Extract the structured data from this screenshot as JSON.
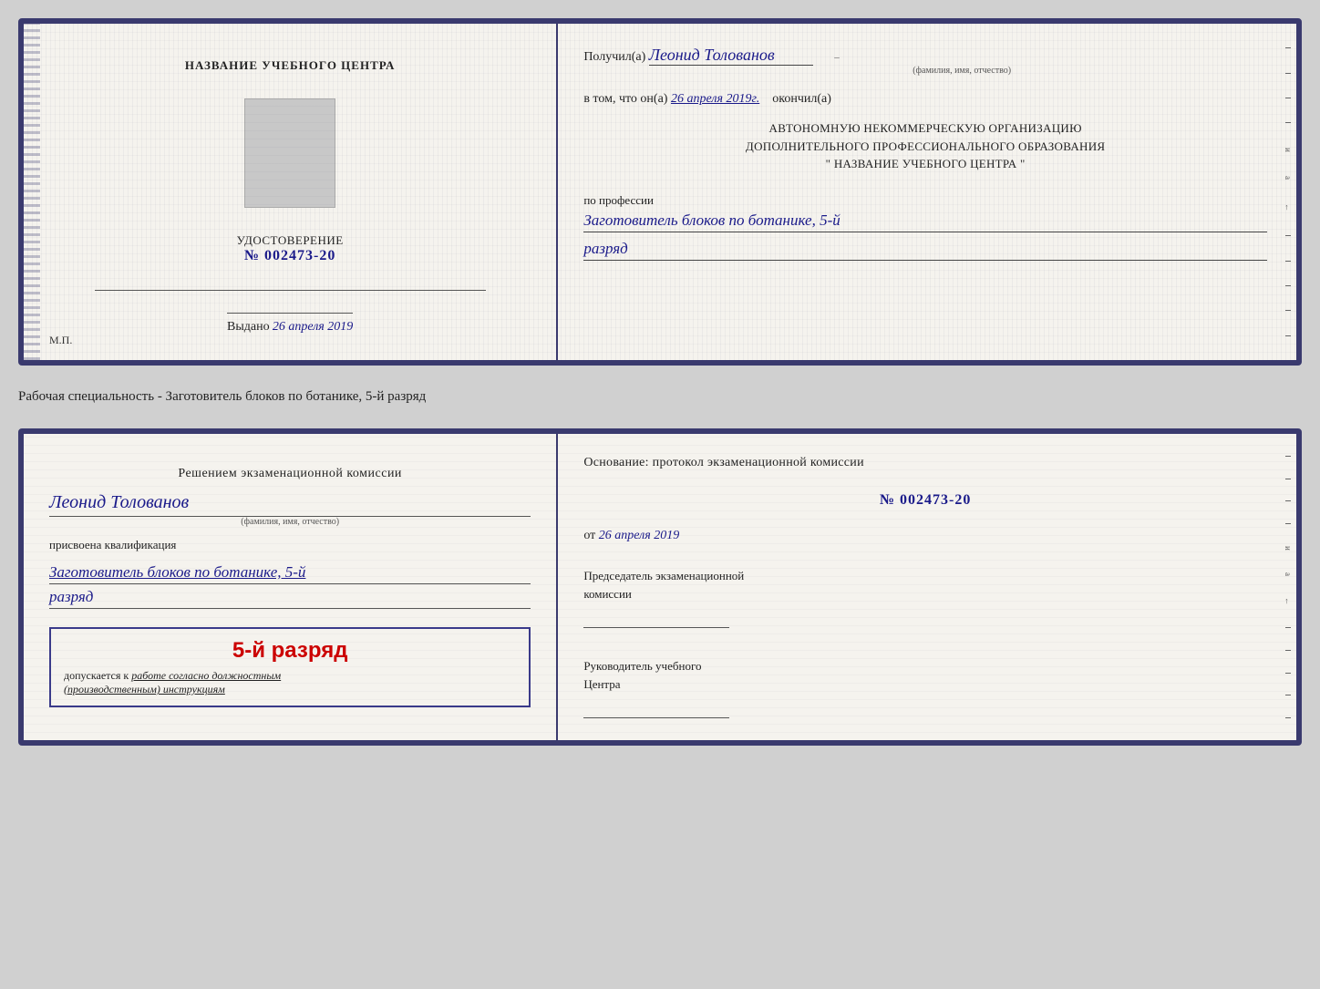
{
  "cert": {
    "left": {
      "title": "НАЗВАНИЕ УЧЕБНОГО ЦЕНТРА",
      "number_label": "УДОСТОВЕРЕНИЕ",
      "number_prefix": "№",
      "number_value": "002473-20",
      "issued_label": "Выдано",
      "issued_date": "26 апреля 2019",
      "mp_label": "М.П."
    },
    "right": {
      "recipient_prefix": "Получил(а)",
      "recipient_name": "Леонид Толованов",
      "recipient_sublabel": "(фамилия, имя, отчество)",
      "date_prefix": "в том, что он(а)",
      "date_value": "26 апреля 2019г.",
      "date_suffix": "окончил(а)",
      "org_line1": "АВТОНОМНУЮ НЕКОММЕРЧЕСКУЮ ОРГАНИЗАЦИЮ",
      "org_line2": "ДОПОЛНИТЕЛЬНОГО ПРОФЕССИОНАЛЬНОГО ОБРАЗОВАНИЯ",
      "org_line3": "\" НАЗВАНИЕ УЧЕБНОГО ЦЕНТРА \"",
      "profession_label": "по профессии",
      "profession_value": "Заготовитель блоков по ботанике, 5-й",
      "rank_value": "разряд"
    }
  },
  "separator": {
    "text": "Рабочая специальность - Заготовитель блоков по ботанике, 5-й разряд"
  },
  "qual": {
    "left": {
      "decision_text": "Решением экзаменационной комиссии",
      "person_name": "Леонид Толованов",
      "person_sublabel": "(фамилия, имя, отчество)",
      "assigned_label": "присвоена квалификация",
      "profession_value": "Заготовитель блоков по ботанике, 5-й",
      "rank_value": "разряд",
      "box_rank": "5-й разряд",
      "box_allowed": "допускается к",
      "box_work": "работе согласно должностным",
      "box_work2": "(производственным) инструкциям"
    },
    "right": {
      "basis_label": "Основание: протокол экзаменационной комиссии",
      "protocol_prefix": "№",
      "protocol_number": "002473-20",
      "date_prefix": "от",
      "date_value": "26 апреля 2019",
      "chairman_line1": "Председатель экзаменационной",
      "chairman_line2": "комиссии",
      "director_line1": "Руководитель учебного",
      "director_line2": "Центра"
    }
  }
}
